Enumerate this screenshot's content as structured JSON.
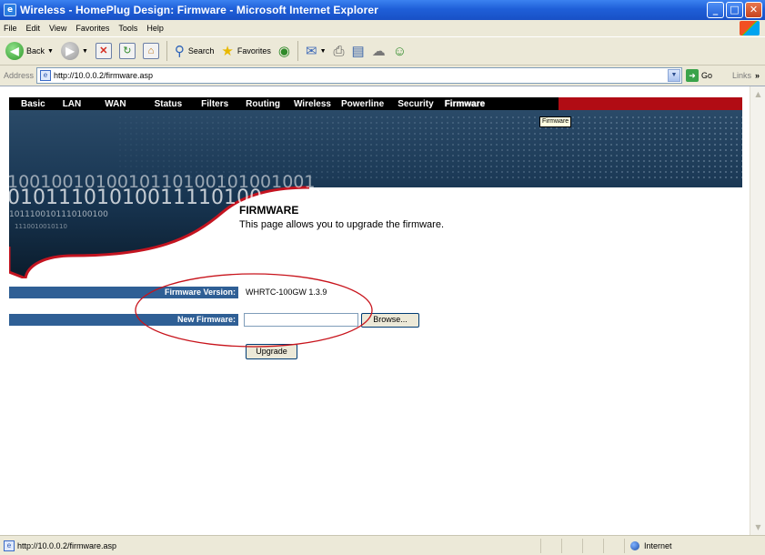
{
  "window": {
    "title": "Wireless - HomePlug Design: Firmware - Microsoft Internet Explorer",
    "app_icon": "e",
    "minimize": "_",
    "maximize": "□",
    "close": "✕"
  },
  "menu": {
    "items": [
      "File",
      "Edit",
      "View",
      "Favorites",
      "Tools",
      "Help"
    ]
  },
  "toolbar": {
    "back": "Back",
    "search": "Search",
    "favorites": "Favorites"
  },
  "address": {
    "label": "Address",
    "url": "http://10.0.0.2/firmware.asp",
    "go": "Go",
    "links": "Links"
  },
  "nav": {
    "items": [
      "Basic",
      "LAN",
      "WAN",
      "Status",
      "Filters",
      "Routing",
      "Wireless",
      "Powerline",
      "Security",
      "Firmware"
    ],
    "active": "Firmware",
    "accent": "#b10c14",
    "tooltip": "Firmware"
  },
  "banner": {
    "binary_line1": "1001001010010110100101001001",
    "binary_line2": "01011101010011110100",
    "binary_line3": "1011100101110100100",
    "binary_line4": "1110010010110"
  },
  "page": {
    "title": "FIRMWARE",
    "description": "This page allows you to upgrade the firmware."
  },
  "form": {
    "version_label": "Firmware Version:",
    "version_value": "WHRTC-100GW 1.3.9",
    "new_label": "New Firmware:",
    "browse": "Browse...",
    "upgrade": "Upgrade"
  },
  "status": {
    "url": "http://10.0.0.2/firmware.asp",
    "zone": "Internet"
  },
  "colors": {
    "label_bg": "#2f5f95",
    "banner_dark": "#0e2336",
    "annotation": "#c8141c"
  }
}
